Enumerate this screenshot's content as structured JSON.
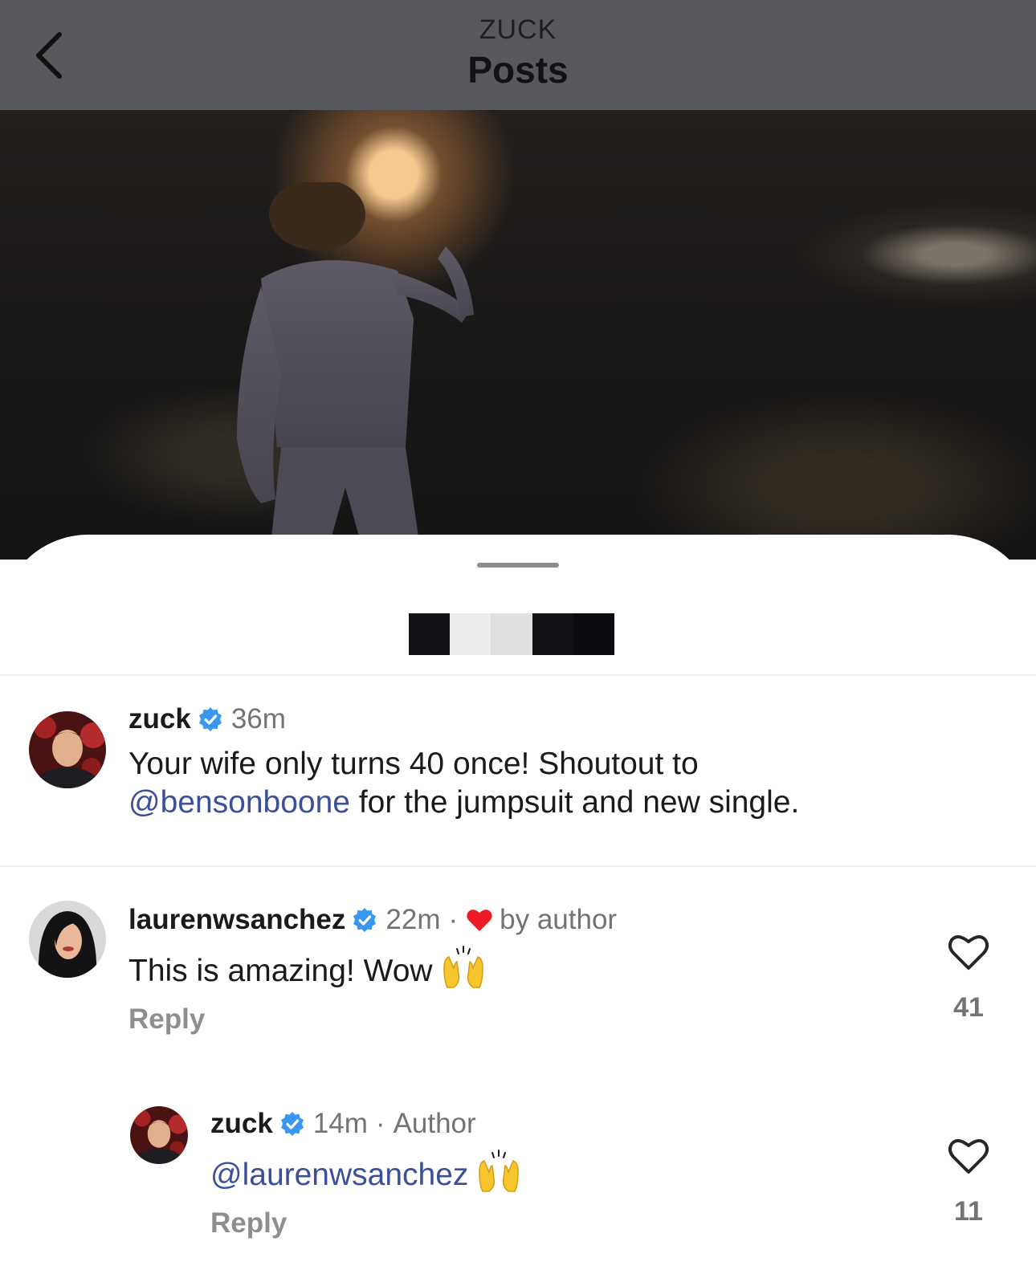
{
  "header": {
    "subtitle": "ZUCK",
    "title": "Posts"
  },
  "post": {
    "author": "zuck",
    "time": "36m",
    "caption_start": "Your wife only turns 40 once! Shoutout to",
    "caption_mention": "@bensonboone",
    "caption_end": " for the jumpsuit and new single."
  },
  "comments": [
    {
      "username": "laurenwsanchez",
      "time": "22m",
      "liked_by_author_label": "by author",
      "text": "This is amazing! Wow",
      "emoji": "raising-hands",
      "reply_label": "Reply",
      "like_count": "41"
    },
    {
      "username": "zuck",
      "time": "14m",
      "author_label": "Author",
      "mention": "@laurenwsanchez",
      "emoji": "raising-hands",
      "reply_label": "Reply",
      "like_count": "11"
    }
  ],
  "colors": {
    "mention": "#3b4f9c",
    "verified": "#3897f0",
    "liked_heart": "#ed1c24",
    "muted_text": "#737373"
  }
}
